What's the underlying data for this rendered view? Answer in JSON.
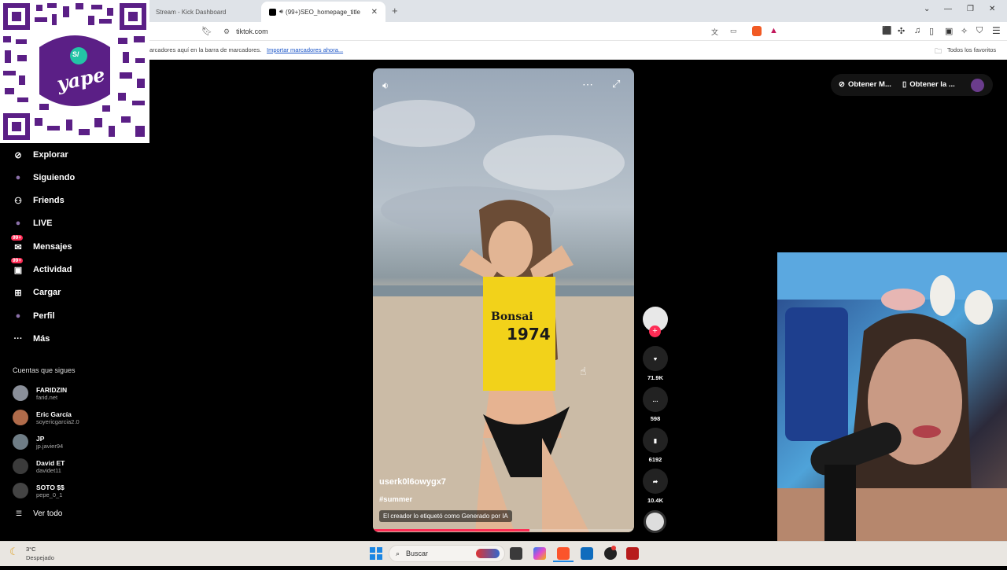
{
  "browser": {
    "tabs": [
      {
        "title": "Stream - Kick Dashboard",
        "active": false
      },
      {
        "title": "(99+)SEO_homepage_title",
        "active": true
      }
    ],
    "url": "tiktok.com",
    "bookmarks_hint": "arcadores aquí en la barra de marcadores.",
    "bookmarks_import": "Importar marcadores ahora...",
    "all_favorites": "Todos los favoritos"
  },
  "overlay": {
    "qr_brand": "yape",
    "qr_badge": "S/"
  },
  "sidebar": {
    "items": [
      {
        "label": "Explorar",
        "icon": "compass-icon"
      },
      {
        "label": "Siguiendo",
        "icon": "avatar-icon"
      },
      {
        "label": "Friends",
        "icon": "people-icon"
      },
      {
        "label": "LIVE",
        "icon": "live-icon"
      },
      {
        "label": "Mensajes",
        "icon": "messages-icon",
        "badge": "99+"
      },
      {
        "label": "Actividad",
        "icon": "activity-icon",
        "badge": "99+"
      },
      {
        "label": "Cargar",
        "icon": "upload-icon"
      },
      {
        "label": "Perfil",
        "icon": "profile-icon"
      },
      {
        "label": "Más",
        "icon": "more-icon"
      }
    ],
    "following_title": "Cuentas que sigues",
    "accounts": [
      {
        "name": "FARIDZIN",
        "handle": "farid.net",
        "color": "#8a8f99"
      },
      {
        "name": "Eric García",
        "handle": "soyericgarcia2.0",
        "color": "#b06b4a"
      },
      {
        "name": "JP",
        "handle": "jp.javier94",
        "color": "#6f7d86"
      },
      {
        "name": "David ET",
        "handle": "davidet11",
        "color": "#3b3b3b"
      },
      {
        "name": "SOTO $$",
        "handle": "pepe_0_1",
        "color": "#444"
      }
    ],
    "see_all": "Ver todo"
  },
  "header": {
    "get_coins": "Obtener M...",
    "get_app": "Obtener la ..."
  },
  "video": {
    "username": "userk0l6owygx7",
    "hashtag": "#summer",
    "ai_label": "El creador lo etiquetó como Generado por IA",
    "progress": 0.6,
    "actions": [
      {
        "name": "like",
        "count": "71.9K"
      },
      {
        "name": "comment",
        "count": "598"
      },
      {
        "name": "bookmark",
        "count": "6192"
      },
      {
        "name": "share",
        "count": "10.4K"
      }
    ]
  },
  "taskbar": {
    "weather_temp": "3°C",
    "weather_desc": "Despejado",
    "search_placeholder": "Buscar"
  },
  "colors": {
    "accent": "#fe2c55",
    "purple": "#6a1b9a"
  }
}
